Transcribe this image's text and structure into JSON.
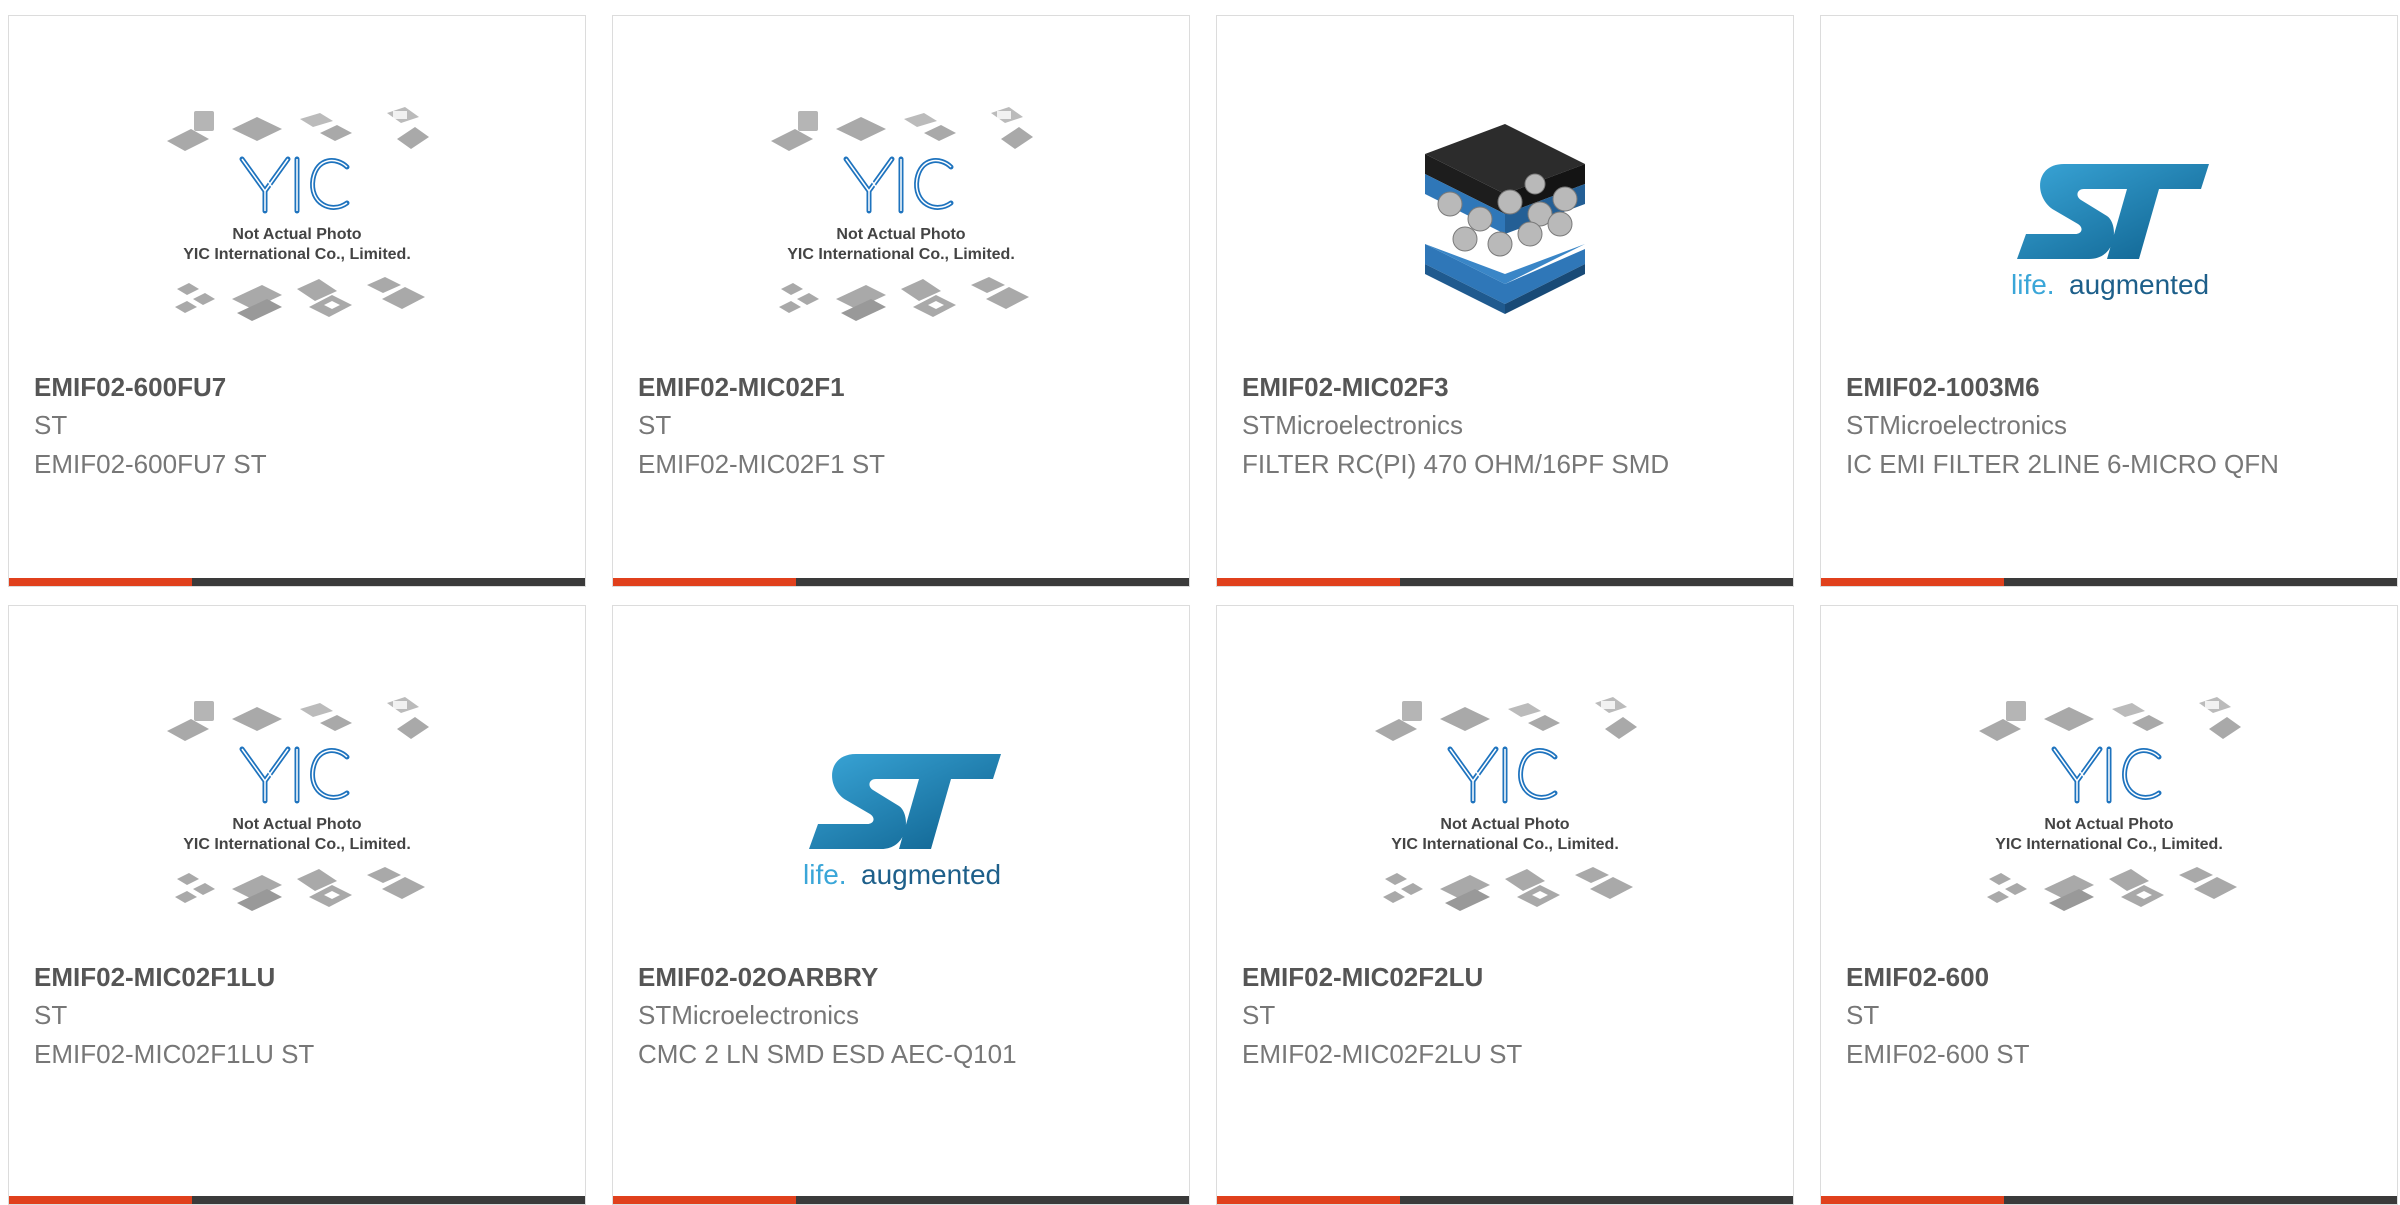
{
  "colors": {
    "accent": "#e0401c",
    "bar": "#3a3a3a",
    "st_blue": "#1f8cc4",
    "yic_blue": "#1e73be"
  },
  "placeholder": {
    "line1": "Not Actual Photo",
    "line2": "YIC International Co., Limited.",
    "logo": "YIC"
  },
  "st_logo": {
    "logo_text": "ST",
    "tagline_a": "life.",
    "tagline_b": "augmented"
  },
  "products": [
    {
      "part": "EMIF02-600FU7",
      "maker": "ST",
      "desc": "EMIF02-600FU7 ST",
      "image": "yic-placeholder"
    },
    {
      "part": "EMIF02-MIC02F1",
      "maker": "ST",
      "desc": "EMIF02-MIC02F1 ST",
      "image": "yic-placeholder"
    },
    {
      "part": "EMIF02-MIC02F3",
      "maker": "STMicroelectronics",
      "desc": "FILTER RC(PI) 470 OHM/16PF SMD",
      "image": "chip-package"
    },
    {
      "part": "EMIF02-1003M6",
      "maker": "STMicroelectronics",
      "desc": "IC EMI FILTER 2LINE 6-MICRO QFN",
      "image": "st-logo"
    },
    {
      "part": "EMIF02-MIC02F1LU",
      "maker": "ST",
      "desc": "EMIF02-MIC02F1LU ST",
      "image": "yic-placeholder"
    },
    {
      "part": "EMIF02-02OARBRY",
      "maker": "STMicroelectronics",
      "desc": "CMC 2 LN SMD ESD AEC-Q101",
      "image": "st-logo"
    },
    {
      "part": "EMIF02-MIC02F2LU",
      "maker": "ST",
      "desc": "EMIF02-MIC02F2LU ST",
      "image": "yic-placeholder"
    },
    {
      "part": "EMIF02-600",
      "maker": "ST",
      "desc": "EMIF02-600 ST",
      "image": "yic-placeholder"
    }
  ]
}
